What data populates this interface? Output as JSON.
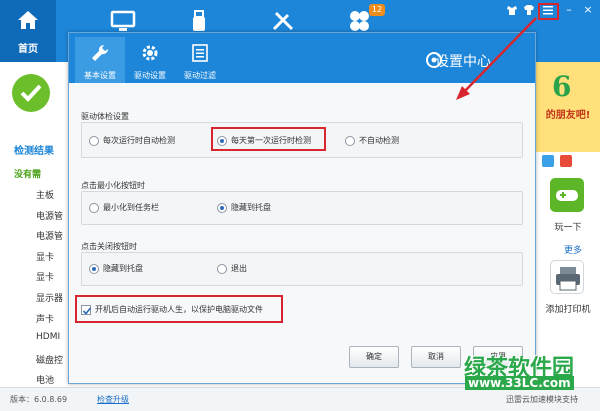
{
  "app": {
    "home_tab_label": "首页",
    "badge_count": "12",
    "window_controls": [
      "–",
      "×"
    ]
  },
  "left_panel": {
    "result_title": "检测结果",
    "result_sub": "没有需",
    "items": [
      "主板",
      "电源管",
      "电源管",
      "显卡",
      "显卡",
      "显示器",
      "声卡",
      "HDMI",
      "磁盘控",
      "电池"
    ]
  },
  "footer": {
    "version": "版本：6.0.8.69",
    "check_update": "检查升级",
    "right_text": "迅雷云加速模块支持"
  },
  "right_panel": {
    "banner_text": "的朋友吧!",
    "tiles": [
      {
        "label": "玩一下",
        "icon": "gamepad-icon"
      },
      {
        "label": "添加打印机",
        "icon": "printer-icon"
      }
    ],
    "more_label": "更多"
  },
  "dialog": {
    "title": "设置中心",
    "tabs": [
      {
        "label": "基本设置",
        "icon": "wrench-icon",
        "active": true
      },
      {
        "label": "驱动设置",
        "icon": "gear-icon",
        "active": false
      },
      {
        "label": "驱动过滤",
        "icon": "list-icon",
        "active": false
      }
    ],
    "groups": [
      {
        "title": "驱动体检设置",
        "options": [
          {
            "label": "每次运行时自动检测",
            "selected": false
          },
          {
            "label": "每天第一次运行时检测",
            "selected": true
          },
          {
            "label": "不自动检测",
            "selected": false
          }
        ]
      },
      {
        "title": "点击最小化按钮时",
        "options": [
          {
            "label": "最小化到任务栏",
            "selected": false
          },
          {
            "label": "隐藏到托盘",
            "selected": true
          }
        ]
      },
      {
        "title": "点击关闭按钮时",
        "options": [
          {
            "label": "隐藏到托盘",
            "selected": true
          },
          {
            "label": "退出",
            "selected": false
          }
        ]
      }
    ],
    "autostart_checkbox": {
      "label": "开机后自动运行驱动人生，以保护电脑驱动文件",
      "checked": true
    },
    "buttons": {
      "ok": "确定",
      "cancel": "取消",
      "apply": "应用"
    }
  },
  "watermark": {
    "logo": "绿茶软件园",
    "url": "www.33LC.com"
  },
  "colors": {
    "brand_blue": "#1d86d8",
    "highlight_red": "#d8262e",
    "success_green": "#6cbf2a"
  }
}
